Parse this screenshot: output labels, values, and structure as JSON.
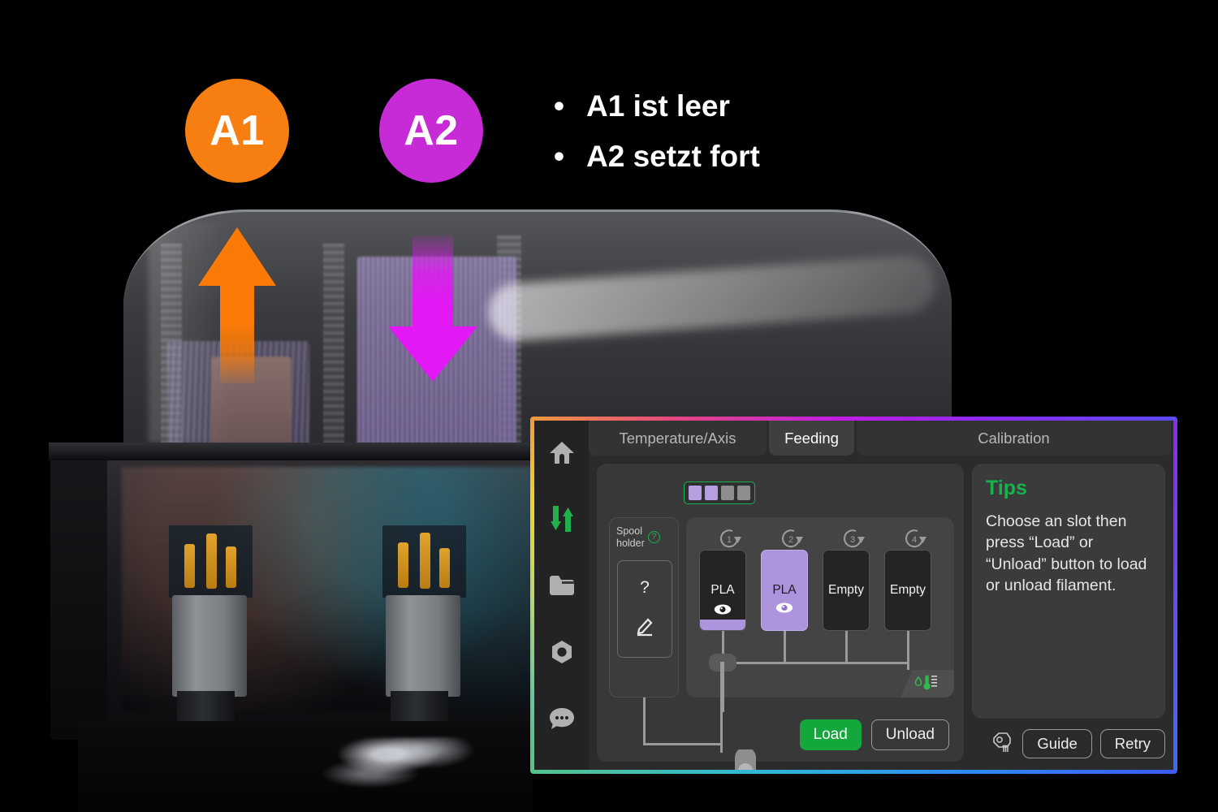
{
  "annotation": {
    "badges": [
      {
        "label": "A1",
        "color": "#F77F12"
      },
      {
        "label": "A2",
        "color": "#C62BD6"
      }
    ],
    "bullets": [
      "A1 ist leer",
      "A2 setzt fort"
    ],
    "arrows": [
      {
        "name": "arrow-up-a1",
        "direction": "up",
        "color": "#FB7A07"
      },
      {
        "name": "arrow-down-a2",
        "direction": "down",
        "color": "#E218F5"
      }
    ]
  },
  "screen": {
    "sidebar": [
      {
        "icon": "home-icon",
        "active": false
      },
      {
        "icon": "sliders-icon",
        "active": true
      },
      {
        "icon": "folder-icon",
        "active": false
      },
      {
        "icon": "nut-icon",
        "active": false
      },
      {
        "icon": "chat-icon",
        "active": false
      }
    ],
    "tabs": [
      {
        "label": "Temperature/Axis",
        "active": false
      },
      {
        "label": "Feeding",
        "active": true
      },
      {
        "label": "Calibration",
        "active": false
      }
    ],
    "unit_selector": {
      "name": "ams-unit-selector",
      "cells": [
        "on",
        "on",
        "off",
        "off"
      ],
      "on_color": "#b79ee0",
      "off_color": "#8d8d8d",
      "outline_color": "#19b24a"
    },
    "spool_holder": {
      "title_line1": "Spool",
      "title_line2": "holder",
      "help": "?",
      "value": "?",
      "edit_icon": "pencil-icon"
    },
    "slots": [
      {
        "index": "1",
        "label": "PLA",
        "selected": false,
        "filament_color": "#ae93dd",
        "eye": true
      },
      {
        "index": "2",
        "label": "PLA",
        "selected": true,
        "filament_color": "#ae93dd",
        "eye": true
      },
      {
        "index": "3",
        "label": "Empty",
        "selected": false,
        "filament_color": "",
        "eye": false
      },
      {
        "index": "4",
        "label": "Empty",
        "selected": false,
        "filament_color": "",
        "eye": false
      }
    ],
    "status_tag": {
      "icon": "humidity-thermometer-icon",
      "color": "#2fb84f"
    },
    "actions": {
      "load": "Load",
      "unload": "Unload",
      "load_color": "#14a83c"
    },
    "tips": {
      "heading": "Tips",
      "body": "Choose an slot then press “Load” or “Unload” button to load or unload filament.",
      "heading_color": "#18b24b"
    },
    "tips_footer": {
      "nozzle_icon": "nozzle-icon",
      "guide": "Guide",
      "retry": "Retry"
    }
  }
}
